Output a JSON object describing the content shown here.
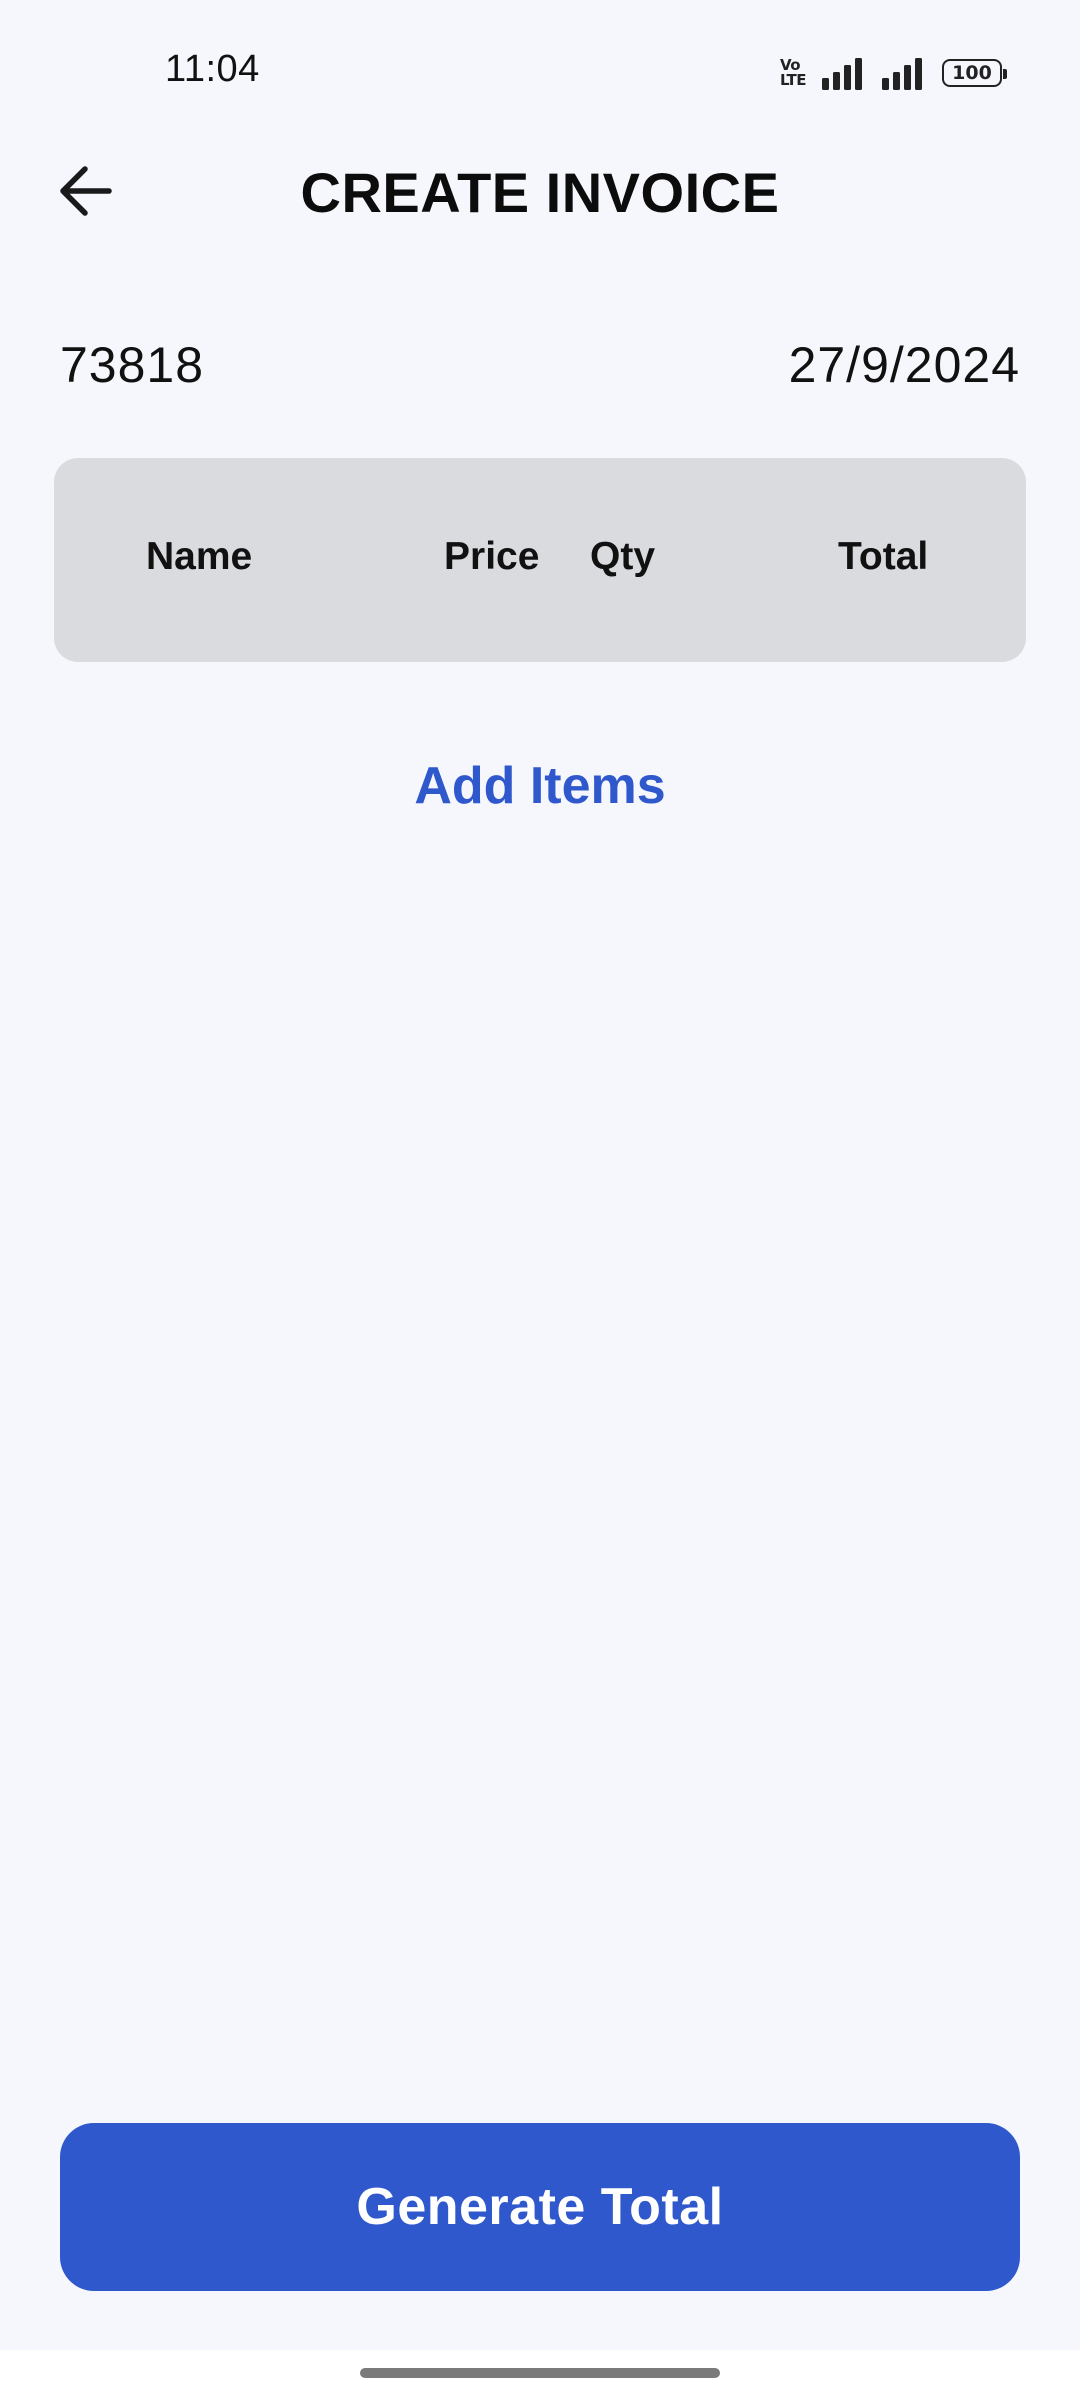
{
  "status_bar": {
    "time": "11:04",
    "volte_top": "Vo",
    "volte_bottom": "LTE",
    "battery": "100"
  },
  "header": {
    "title": "CREATE INVOICE",
    "back_icon": "arrow-left-icon"
  },
  "invoice": {
    "number": "73818",
    "date": "27/9/2024"
  },
  "table": {
    "columns": [
      "Name",
      "Price",
      "Qty",
      "Total"
    ]
  },
  "actions": {
    "add_items_label": "Add Items",
    "generate_label": "Generate Total"
  },
  "colors": {
    "accent": "#2f58cd",
    "background": "#f6f7fc",
    "table_header_bg": "#dadbdf"
  }
}
